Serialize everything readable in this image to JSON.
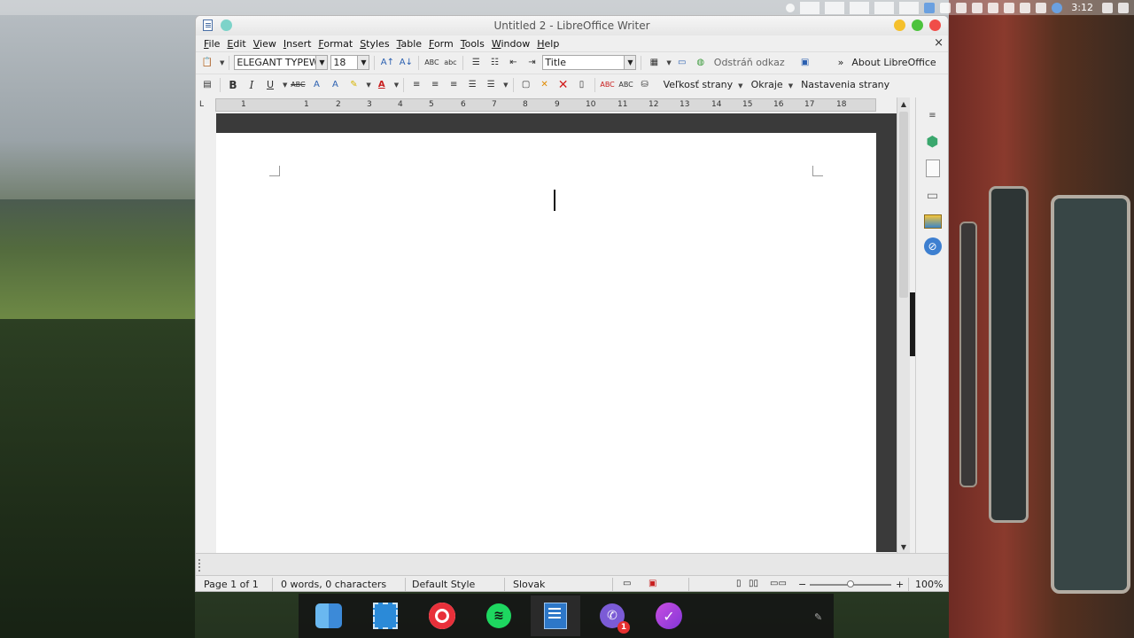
{
  "top_panel": {
    "clock": "3:12"
  },
  "window": {
    "title": "Untitled 2 - LibreOffice Writer"
  },
  "menubar": {
    "items": [
      {
        "u": "F",
        "rest": "ile"
      },
      {
        "u": "E",
        "rest": "dit"
      },
      {
        "u": "V",
        "rest": "iew"
      },
      {
        "u": "I",
        "rest": "nsert"
      },
      {
        "u": "F",
        "rest": "ormat"
      },
      {
        "u": "S",
        "rest": "tyles"
      },
      {
        "u": "T",
        "rest": "able"
      },
      {
        "u": "F",
        "rest": "orm"
      },
      {
        "u": "T",
        "rest": "ools"
      },
      {
        "u": "W",
        "rest": "indow"
      },
      {
        "u": "H",
        "rest": "elp"
      }
    ],
    "close_glyph": "×"
  },
  "toolbar1": {
    "font_name": "ELEGANT TYPEW",
    "font_size": "18",
    "para_style": "Title",
    "remove_link": "Odstráň odkaz",
    "more": "»",
    "about": "About LibreOffice"
  },
  "toolbar2": {
    "bold": "B",
    "italic": "I",
    "underline": "U",
    "strike": "ABC",
    "font_color": "A",
    "page_size": "Veľkosť strany",
    "margins": "Okraje",
    "page_settings": "Nastavenia strany"
  },
  "ruler": {
    "corner": "L",
    "labels": [
      "1",
      "1",
      "2",
      "3",
      "4",
      "5",
      "6",
      "7",
      "8",
      "9",
      "10",
      "11",
      "12",
      "13",
      "14",
      "15",
      "16",
      "17",
      "18"
    ]
  },
  "statusbar": {
    "page": "Page 1 of 1",
    "words": "0 words, 0 characters",
    "style": "Default Style",
    "language": "Slovak",
    "zoom": "100%",
    "zoom_minus": "−",
    "zoom_plus": "+"
  },
  "dock": {
    "viber_badge": "1"
  },
  "colors": {
    "accent_blue": "#2d77c8",
    "close_red": "#f04d48",
    "minimize_yellow": "#f5c02c",
    "maximize_green": "#4cc33d"
  }
}
